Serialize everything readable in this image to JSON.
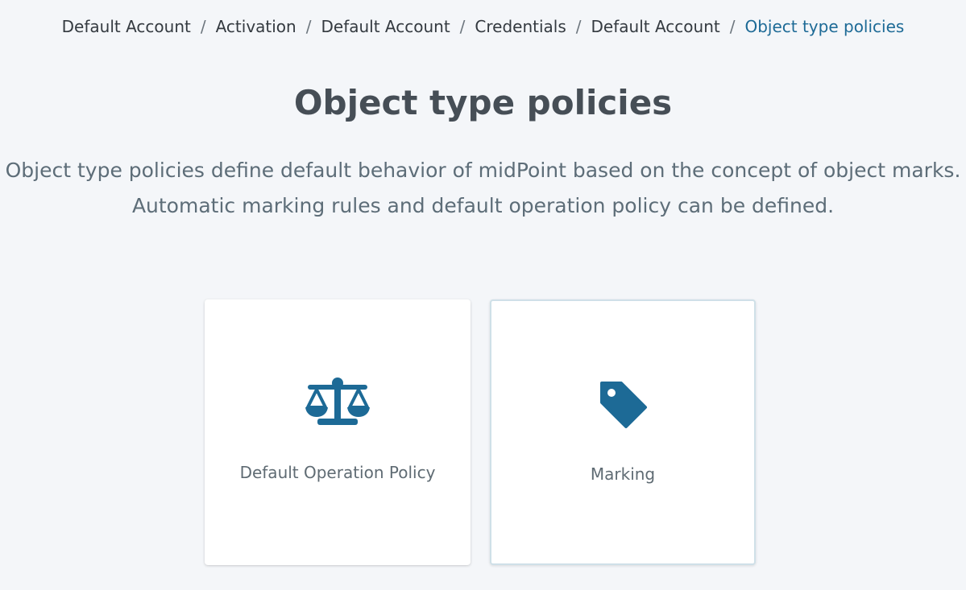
{
  "breadcrumb": {
    "items": [
      "Default Account",
      "Activation",
      "Default Account",
      "Credentials",
      "Default Account",
      "Object type policies"
    ],
    "separator": "/"
  },
  "page": {
    "title": "Object type policies",
    "description_line1": "Object type policies define default behavior of midPoint based on the concept of object marks.",
    "description_line2": "Automatic marking rules and default operation policy can be defined."
  },
  "cards": [
    {
      "label": "Default Operation Policy",
      "icon": "balance-scale-icon"
    },
    {
      "label": "Marking",
      "icon": "tag-icon"
    }
  ],
  "colors": {
    "accent": "#1d6a96",
    "background": "#f4f6f9",
    "card": "#ffffff"
  }
}
